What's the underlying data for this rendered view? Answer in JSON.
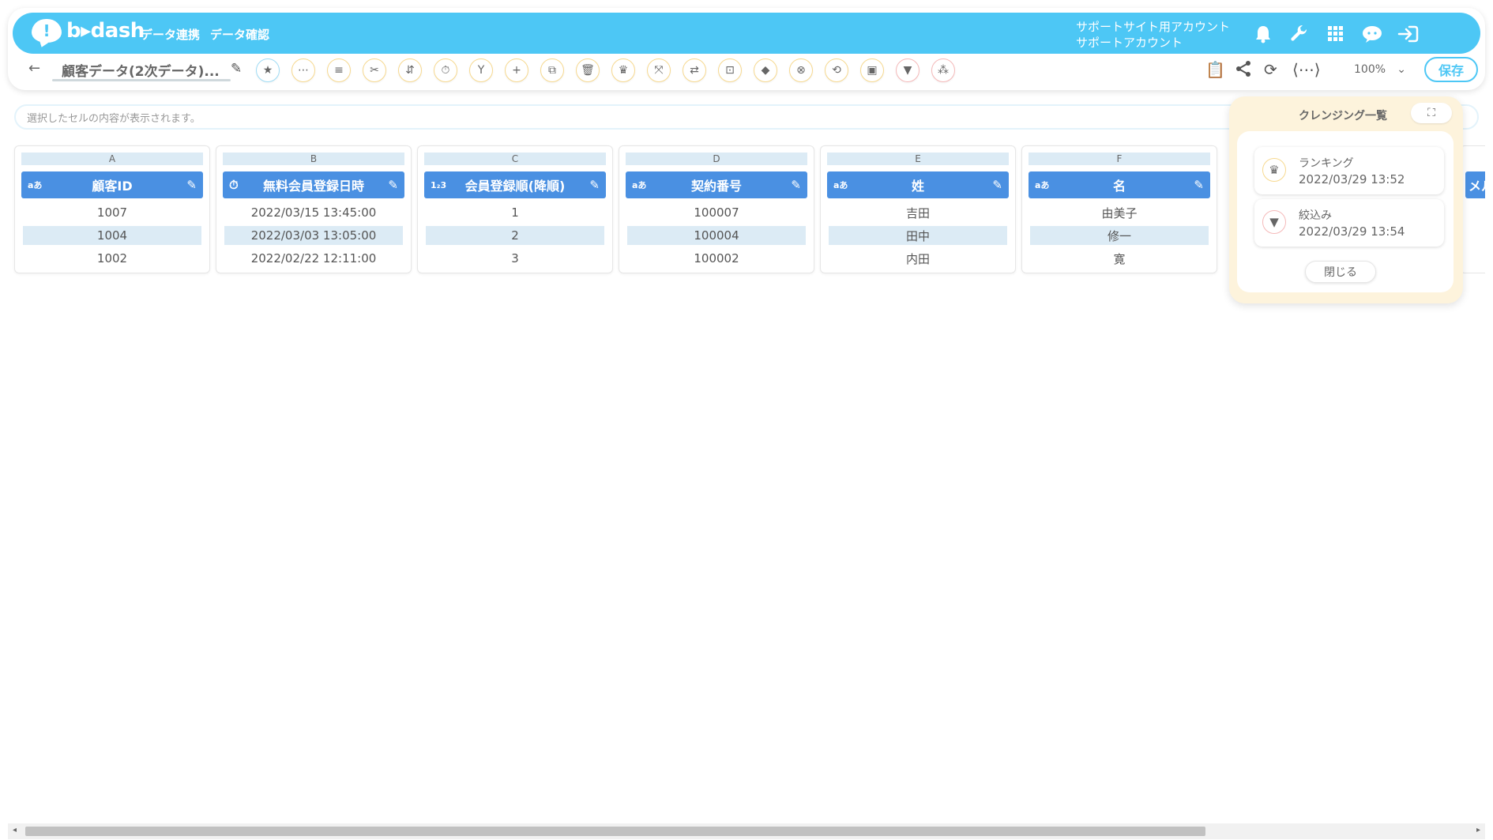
{
  "header": {
    "logo_text": "b▸dash",
    "logo_mark": "!",
    "nav": [
      "データ連携",
      "データ確認"
    ],
    "account_line1": "サポートサイト用アカウント",
    "account_line2": "サポートアカウント",
    "icons": [
      "bell-icon",
      "wrench-icon",
      "apps-grid-icon",
      "chat-bot-icon",
      "logout-icon"
    ]
  },
  "toolbar": {
    "back": "←",
    "title": "顧客データ(2次データ)...",
    "zoom": "100%",
    "save_label": "保存"
  },
  "cell_bar": {
    "placeholder": "選択したセルの内容が表示されます。"
  },
  "columns": [
    {
      "letter": "A",
      "type": "aあ",
      "name": "顧客ID",
      "cells": [
        "1007",
        "1004",
        "1002"
      ]
    },
    {
      "letter": "B",
      "type": "⏱",
      "name": "無料会員登録日時",
      "cells": [
        "2022/03/15 13:45:00",
        "2022/03/03 13:05:00",
        "2022/02/22 12:11:00"
      ]
    },
    {
      "letter": "C",
      "type": "1₂3",
      "name": "会員登録順(降順)",
      "cells": [
        "1",
        "2",
        "3"
      ]
    },
    {
      "letter": "D",
      "type": "aあ",
      "name": "契約番号",
      "cells": [
        "100007",
        "100004",
        "100002"
      ]
    },
    {
      "letter": "E",
      "type": "aあ",
      "name": "姓",
      "cells": [
        "吉田",
        "田中",
        "内田"
      ]
    },
    {
      "letter": "F",
      "type": "aあ",
      "name": "名",
      "cells": [
        "由美子",
        "修一",
        "寛"
      ]
    }
  ],
  "partial_column": {
    "name": "メル"
  },
  "cleansing_panel": {
    "title": "クレンジング一覧",
    "items": [
      {
        "name": "ランキング",
        "time": "2022/03/29 13:52",
        "icon": "crown-icon"
      },
      {
        "name": "絞込み",
        "time": "2022/03/29 13:54",
        "icon": "filter-icon"
      }
    ],
    "close_label": "閉じる"
  }
}
